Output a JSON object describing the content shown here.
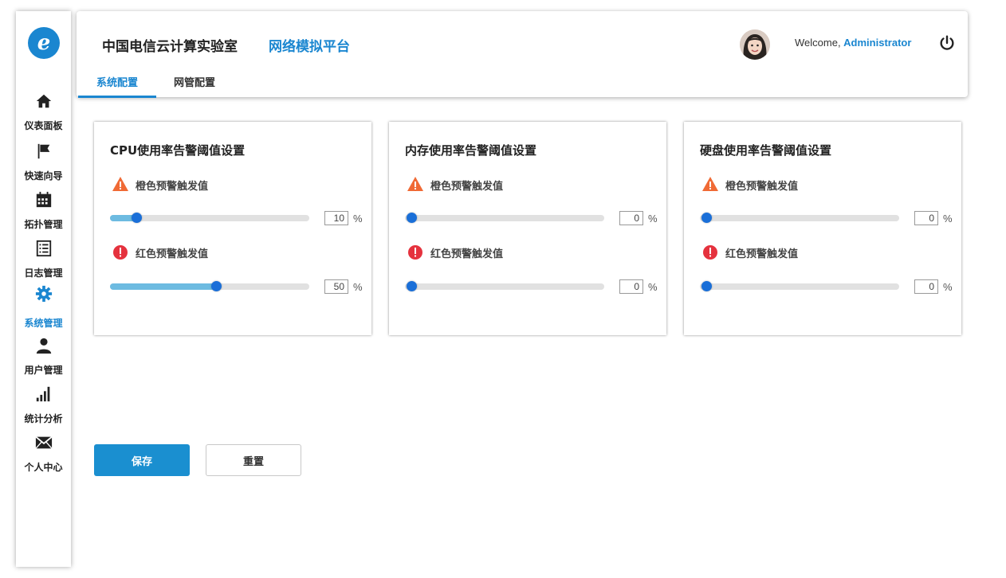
{
  "brand": {
    "logo_glyph": "e",
    "color": "#1a86d0"
  },
  "sidebar": {
    "items": [
      {
        "label": "仪表面板",
        "icon": "home-icon",
        "active": false
      },
      {
        "label": "快速向导",
        "icon": "flag-icon",
        "active": false
      },
      {
        "label": "拓扑管理",
        "icon": "calendar-icon",
        "active": false
      },
      {
        "label": "日志管理",
        "icon": "list-icon",
        "active": false
      },
      {
        "label": "系统管理",
        "icon": "gear-icon",
        "active": true
      },
      {
        "label": "用户管理",
        "icon": "user-icon",
        "active": false
      },
      {
        "label": "统计分析",
        "icon": "bar-chart-icon",
        "active": false
      },
      {
        "label": "个人中心",
        "icon": "mail-icon",
        "active": false
      }
    ]
  },
  "header": {
    "title": "中国电信云计算实验室",
    "subtitle": "网络模拟平台",
    "tabs": [
      {
        "label": "系统配置",
        "active": true
      },
      {
        "label": "网管配置",
        "active": false
      }
    ],
    "welcome_prefix": "Welcome, ",
    "username": "Administrator"
  },
  "cards": [
    {
      "title": "CPU使用率告警阈值设置",
      "orange_label": "橙色预警触发值",
      "orange_value": "10",
      "red_label": "红色预警触发值",
      "red_value": "50",
      "unit": "%"
    },
    {
      "title": "内存使用率告警阈值设置",
      "orange_label": "橙色预警触发值",
      "orange_value": "0",
      "red_label": "红色预警触发值",
      "red_value": "0",
      "unit": "%"
    },
    {
      "title": "硬盘使用率告警阈值设置",
      "orange_label": "橙色预警触发值",
      "orange_value": "0",
      "red_label": "红色预警触发值",
      "red_value": "0",
      "unit": "%"
    }
  ],
  "buttons": {
    "save": "保存",
    "reset": "重置"
  },
  "colors": {
    "accent": "#1a86d0",
    "warning_orange": "#f06a35",
    "danger_red": "#e5323e",
    "slider_fill": "#6dbbe1",
    "slider_handle": "#1a6fd8"
  }
}
